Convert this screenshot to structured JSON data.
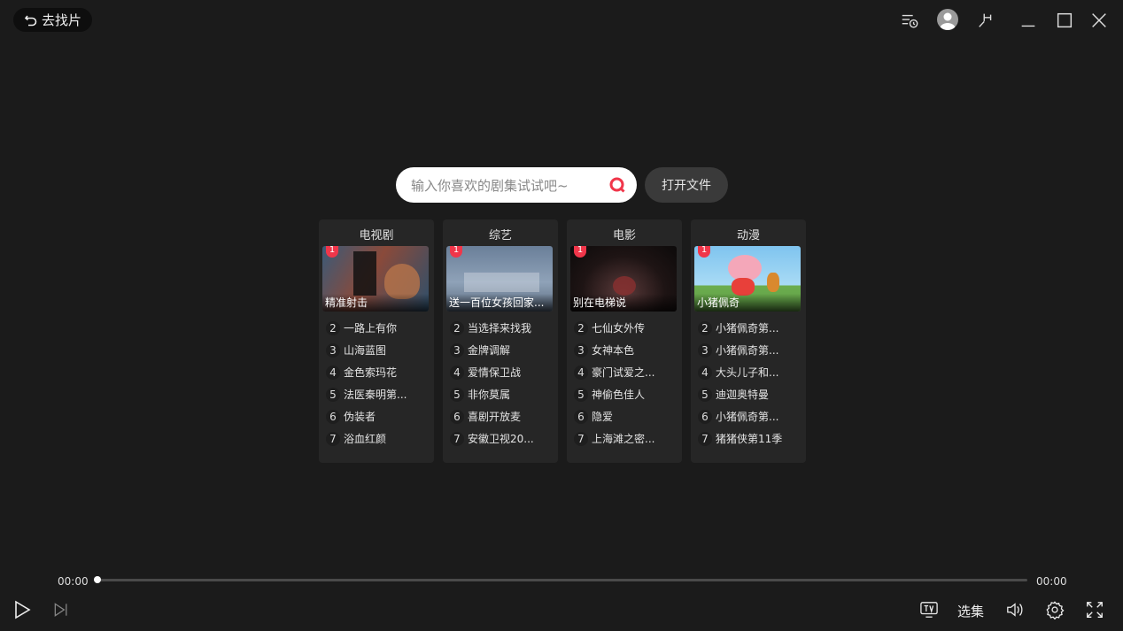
{
  "topbar": {
    "back_label": "去找片",
    "icons": [
      "back-arrow-icon",
      "playlist-history-icon",
      "avatar-icon",
      "pin-icon",
      "minimize-icon",
      "maximize-icon",
      "close-icon"
    ]
  },
  "search": {
    "placeholder": "输入你喜欢的剧集试试吧~",
    "open_file_label": "打开文件",
    "accent_color": "#f0364a"
  },
  "categories": [
    {
      "title": "电视剧",
      "top": {
        "rank": "1",
        "caption": "精准射击"
      },
      "items": [
        {
          "rank": "2",
          "label": "一路上有你"
        },
        {
          "rank": "3",
          "label": "山海蓝图"
        },
        {
          "rank": "4",
          "label": "金色索玛花"
        },
        {
          "rank": "5",
          "label": "法医秦明第..."
        },
        {
          "rank": "6",
          "label": "伪装者"
        },
        {
          "rank": "7",
          "label": "浴血红颜"
        }
      ]
    },
    {
      "title": "综艺",
      "top": {
        "rank": "1",
        "caption": "送一百位女孩回家..."
      },
      "items": [
        {
          "rank": "2",
          "label": "当选择来找我"
        },
        {
          "rank": "3",
          "label": "金牌调解"
        },
        {
          "rank": "4",
          "label": "爱情保卫战"
        },
        {
          "rank": "5",
          "label": "非你莫属"
        },
        {
          "rank": "6",
          "label": "喜剧开放麦"
        },
        {
          "rank": "7",
          "label": "安徽卫视20..."
        }
      ]
    },
    {
      "title": "电影",
      "top": {
        "rank": "1",
        "caption": "别在电梯说"
      },
      "items": [
        {
          "rank": "2",
          "label": "七仙女外传"
        },
        {
          "rank": "3",
          "label": "女神本色"
        },
        {
          "rank": "4",
          "label": "豪门试爱之..."
        },
        {
          "rank": "5",
          "label": "神偷色佳人"
        },
        {
          "rank": "6",
          "label": "隐爱"
        },
        {
          "rank": "7",
          "label": "上海滩之密..."
        }
      ]
    },
    {
      "title": "动漫",
      "top": {
        "rank": "1",
        "caption": "小猪佩奇"
      },
      "items": [
        {
          "rank": "2",
          "label": "小猪佩奇第..."
        },
        {
          "rank": "3",
          "label": "小猪佩奇第..."
        },
        {
          "rank": "4",
          "label": "大头儿子和..."
        },
        {
          "rank": "5",
          "label": "迪迦奥特曼"
        },
        {
          "rank": "6",
          "label": "小猪佩奇第..."
        },
        {
          "rank": "7",
          "label": "猪猪侠第11季"
        }
      ]
    }
  ],
  "player": {
    "current_time": "00:00",
    "total_time": "00:00",
    "progress": 0,
    "select_episode_label": "选集"
  }
}
